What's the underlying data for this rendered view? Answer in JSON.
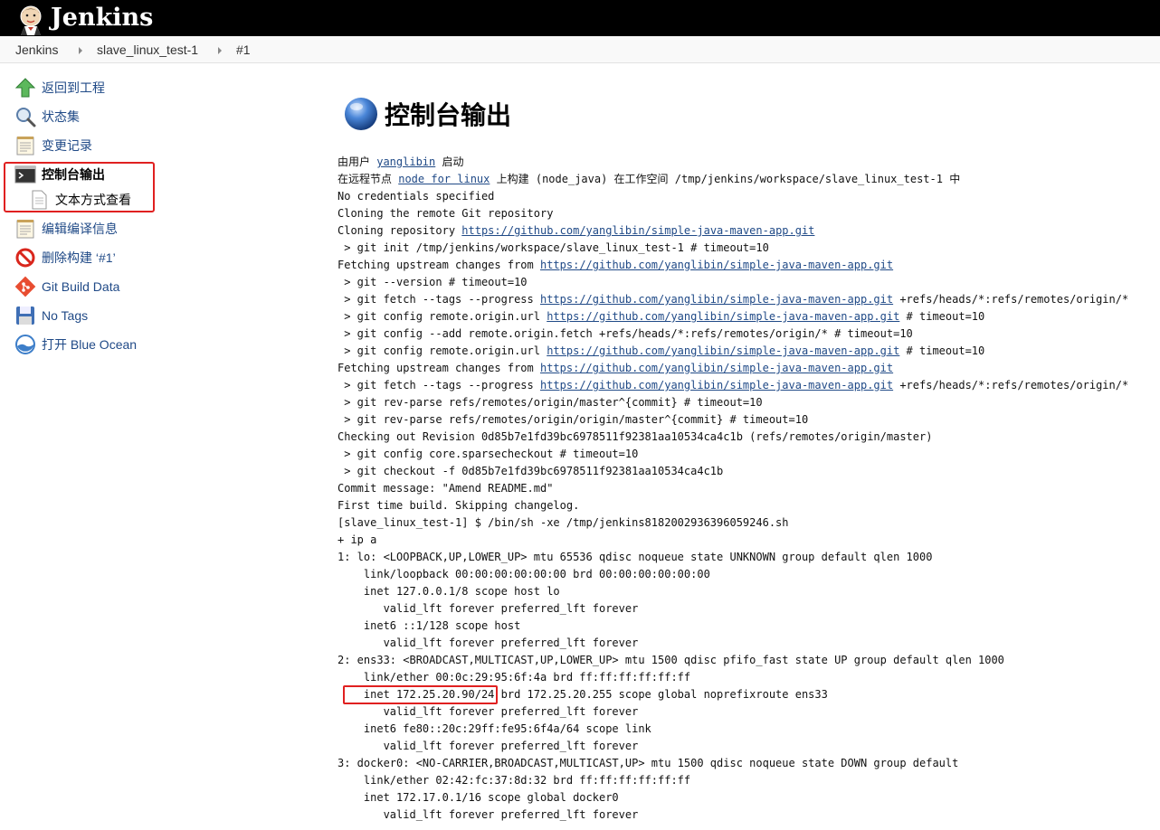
{
  "header": {
    "brand": "Jenkins"
  },
  "breadcrumb": [
    "Jenkins",
    "slave_linux_test-1",
    "#1"
  ],
  "sidebar": {
    "items": [
      {
        "label": "返回到工程",
        "icon": "up-arrow-icon"
      },
      {
        "label": "状态集",
        "icon": "magnifier-icon"
      },
      {
        "label": "变更记录",
        "icon": "notepad-icon"
      },
      {
        "label": "控制台输出",
        "icon": "terminal-icon",
        "active": true
      },
      {
        "label": "文本方式查看",
        "icon": "document-icon",
        "sub": true
      },
      {
        "label": "编辑编译信息",
        "icon": "notepad-icon"
      },
      {
        "label": "删除构建 ‘#1’",
        "icon": "no-entry-icon"
      },
      {
        "label": "Git Build Data",
        "icon": "git-icon"
      },
      {
        "label": "No Tags",
        "icon": "save-icon"
      },
      {
        "label": "打开 Blue Ocean",
        "icon": "blue-ocean-icon"
      }
    ]
  },
  "main": {
    "title": "控制台输出",
    "console": [
      [
        {
          "t": "由用户 "
        },
        {
          "t": "yanglibin",
          "link": true
        },
        {
          "t": " 启动"
        }
      ],
      [
        {
          "t": "在远程节点 "
        },
        {
          "t": "node for linux",
          "link": true
        },
        {
          "t": " 上构建 (node_java) 在工作空间 /tmp/jenkins/workspace/slave_linux_test-1 中"
        }
      ],
      [
        {
          "t": "No credentials specified"
        }
      ],
      [
        {
          "t": "Cloning the remote Git repository"
        }
      ],
      [
        {
          "t": "Cloning repository "
        },
        {
          "t": "https://github.com/yanglibin/simple-java-maven-app.git",
          "link": true
        }
      ],
      [
        {
          "t": " > git init /tmp/jenkins/workspace/slave_linux_test-1 # timeout=10"
        }
      ],
      [
        {
          "t": "Fetching upstream changes from "
        },
        {
          "t": "https://github.com/yanglibin/simple-java-maven-app.git",
          "link": true
        }
      ],
      [
        {
          "t": " > git --version # timeout=10"
        }
      ],
      [
        {
          "t": " > git fetch --tags --progress "
        },
        {
          "t": "https://github.com/yanglibin/simple-java-maven-app.git",
          "link": true
        },
        {
          "t": " +refs/heads/*:refs/remotes/origin/*"
        }
      ],
      [
        {
          "t": " > git config remote.origin.url "
        },
        {
          "t": "https://github.com/yanglibin/simple-java-maven-app.git",
          "link": true
        },
        {
          "t": " # timeout=10"
        }
      ],
      [
        {
          "t": " > git config --add remote.origin.fetch +refs/heads/*:refs/remotes/origin/* # timeout=10"
        }
      ],
      [
        {
          "t": " > git config remote.origin.url "
        },
        {
          "t": "https://github.com/yanglibin/simple-java-maven-app.git",
          "link": true
        },
        {
          "t": " # timeout=10"
        }
      ],
      [
        {
          "t": "Fetching upstream changes from "
        },
        {
          "t": "https://github.com/yanglibin/simple-java-maven-app.git",
          "link": true
        }
      ],
      [
        {
          "t": " > git fetch --tags --progress "
        },
        {
          "t": "https://github.com/yanglibin/simple-java-maven-app.git",
          "link": true
        },
        {
          "t": " +refs/heads/*:refs/remotes/origin/*"
        }
      ],
      [
        {
          "t": " > git rev-parse refs/remotes/origin/master^{commit} # timeout=10"
        }
      ],
      [
        {
          "t": " > git rev-parse refs/remotes/origin/origin/master^{commit} # timeout=10"
        }
      ],
      [
        {
          "t": "Checking out Revision 0d85b7e1fd39bc6978511f92381aa10534ca4c1b (refs/remotes/origin/master)"
        }
      ],
      [
        {
          "t": " > git config core.sparsecheckout # timeout=10"
        }
      ],
      [
        {
          "t": " > git checkout -f 0d85b7e1fd39bc6978511f92381aa10534ca4c1b"
        }
      ],
      [
        {
          "t": "Commit message: \"Amend README.md\""
        }
      ],
      [
        {
          "t": "First time build. Skipping changelog."
        }
      ],
      [
        {
          "t": "[slave_linux_test-1] $ /bin/sh -xe /tmp/jenkins8182002936396059246.sh"
        }
      ],
      [
        {
          "t": "+ ip a"
        }
      ],
      [
        {
          "t": "1: lo: <LOOPBACK,UP,LOWER_UP> mtu 65536 qdisc noqueue state UNKNOWN group default qlen 1000"
        }
      ],
      [
        {
          "t": "    link/loopback 00:00:00:00:00:00 brd 00:00:00:00:00:00"
        }
      ],
      [
        {
          "t": "    inet 127.0.0.1/8 scope host lo"
        }
      ],
      [
        {
          "t": "       valid_lft forever preferred_lft forever"
        }
      ],
      [
        {
          "t": "    inet6 ::1/128 scope host"
        }
      ],
      [
        {
          "t": "       valid_lft forever preferred_lft forever"
        }
      ],
      [
        {
          "t": "2: ens33: <BROADCAST,MULTICAST,UP,LOWER_UP> mtu 1500 qdisc pfifo_fast state UP group default qlen 1000"
        }
      ],
      [
        {
          "t": "    link/ether 00:0c:29:95:6f:4a brd ff:ff:ff:ff:ff:ff"
        }
      ],
      [
        {
          "t": "    inet 172.25.20.90/24 brd 172.25.20.255 scope global noprefixroute ens33"
        }
      ],
      [
        {
          "t": "       valid_lft forever preferred_lft forever"
        }
      ],
      [
        {
          "t": "    inet6 fe80::20c:29ff:fe95:6f4a/64 scope link"
        }
      ],
      [
        {
          "t": "       valid_lft forever preferred_lft forever"
        }
      ],
      [
        {
          "t": "3: docker0: <NO-CARRIER,BROADCAST,MULTICAST,UP> mtu 1500 qdisc noqueue state DOWN group default"
        }
      ],
      [
        {
          "t": "    link/ether 02:42:fc:37:8d:32 brd ff:ff:ff:ff:ff:ff"
        }
      ],
      [
        {
          "t": "    inet 172.17.0.1/16 scope global docker0"
        }
      ],
      [
        {
          "t": "       valid_lft forever preferred_lft forever"
        }
      ]
    ]
  },
  "colors": {
    "header_bg": "#000000",
    "link": "#204a87",
    "highlight": "#e02020"
  }
}
